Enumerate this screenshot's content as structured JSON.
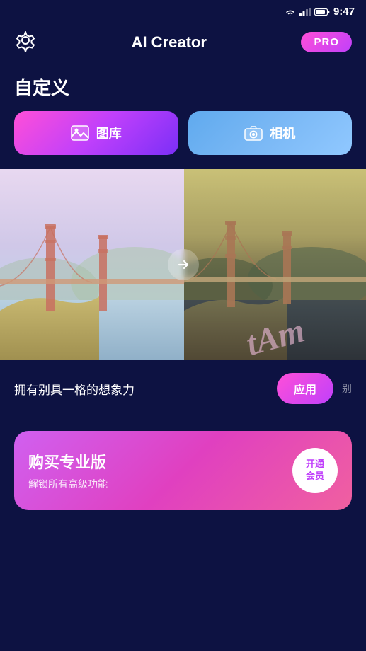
{
  "statusBar": {
    "time": "9:47"
  },
  "header": {
    "title": "AI Creator",
    "proLabel": "PRO"
  },
  "section": {
    "title": "自定义"
  },
  "buttons": {
    "gallery": "图库",
    "camera": "相机"
  },
  "imageSection": {
    "arrowLabel": "→"
  },
  "applyRow": {
    "text": "拥有别具一格的想象力",
    "applyBtn": "应用",
    "nextText": "别"
  },
  "proCard": {
    "title": "购买专业版",
    "subtitle": "解锁所有高级功能",
    "btnLine1": "开通",
    "btnLine2": "会员"
  }
}
